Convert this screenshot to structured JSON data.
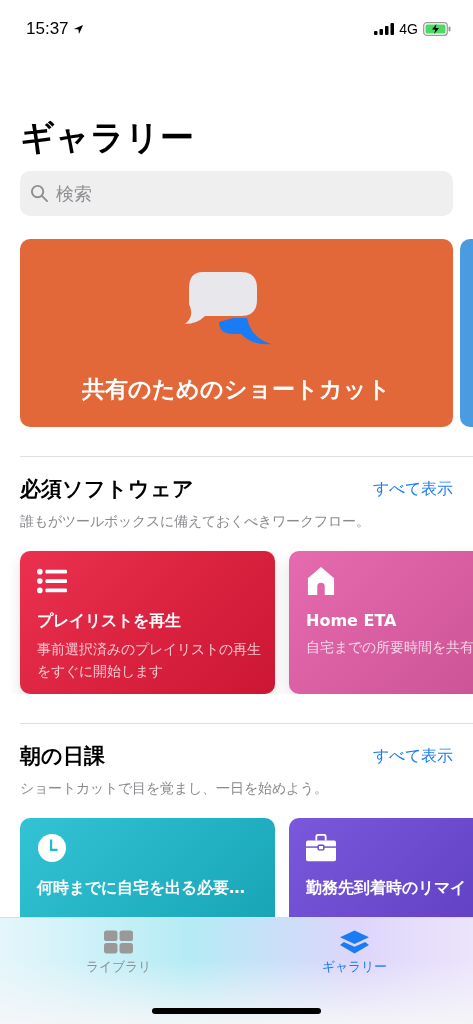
{
  "status_bar": {
    "time": "15:37",
    "network": "4G"
  },
  "title": "ギャラリー",
  "search": {
    "placeholder": "検索"
  },
  "banners": [
    {
      "title": "共有のためのショートカット",
      "color": "#e2683a"
    },
    {
      "color": "#4a9be0"
    }
  ],
  "sections": [
    {
      "title": "必須ソフトウェア",
      "link": "すべて表示",
      "subtitle": "誰もがツールボックスに備えておくべきワークフロー。",
      "cards": [
        {
          "kind": "list",
          "title": "プレイリストを再生",
          "description": "事前選択済みのプレイリストの再生をすぐに開始します",
          "color": "#e8193a"
        },
        {
          "kind": "home",
          "title": "Home ETA",
          "description": "自宅までの所要時間を共有",
          "color": "#e35aa5"
        }
      ]
    },
    {
      "title": "朝の日課",
      "link": "すべて表示",
      "subtitle": "ショートカットで目を覚まし、一日を始めよう。",
      "cards": [
        {
          "kind": "clock",
          "title": "何時までに自宅を出る必要…",
          "color": "#1bbcd0"
        },
        {
          "kind": "briefcase",
          "title": "勤務先到着時のリマイ",
          "color": "#6a45d8"
        }
      ]
    }
  ],
  "tabs": [
    {
      "kind": "grid",
      "label": "ライブラリ",
      "selected": false
    },
    {
      "kind": "layers",
      "label": "ギャラリー",
      "selected": true
    }
  ]
}
